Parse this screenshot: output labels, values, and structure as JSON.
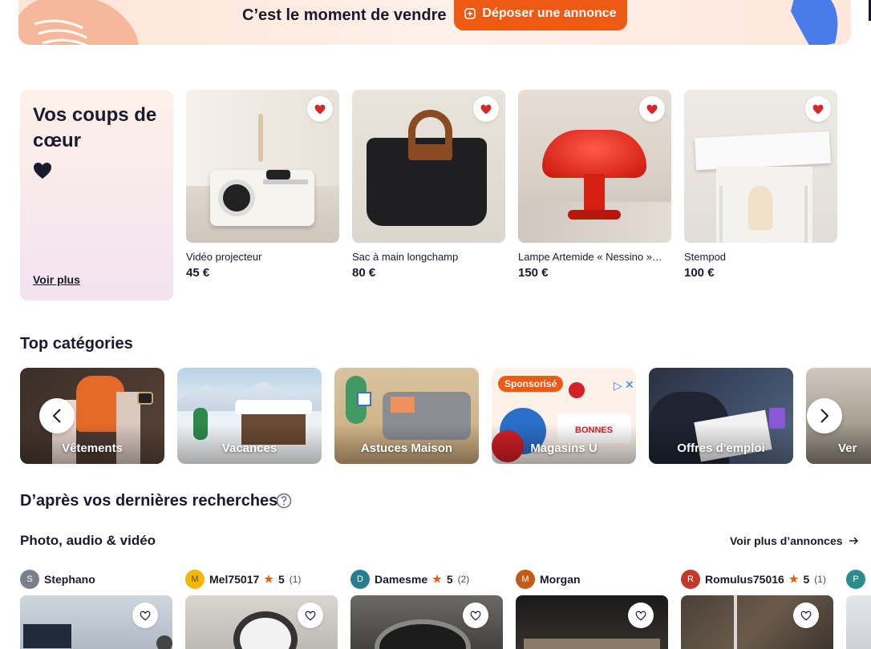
{
  "banner": {
    "text": "C’est le moment de vendre",
    "button_label": "Déposer une annonce"
  },
  "favorites": {
    "title": "Vos coups de cœur",
    "see_more": "Voir plus",
    "products": [
      {
        "title": "Vidéo projecteur",
        "price": "45 €"
      },
      {
        "title": "Sac à main longchamp",
        "price": "80 €"
      },
      {
        "title": "Lampe Artemide « Nessino »…",
        "price": "150 €"
      },
      {
        "title": "Stempod",
        "price": "100 €"
      }
    ]
  },
  "categories": {
    "title": "Top catégories",
    "items": [
      {
        "label": "Vêtements"
      },
      {
        "label": "Vacances"
      },
      {
        "label": "Astuces Maison"
      },
      {
        "label": "Magasins U",
        "badge": "Sponsorisé"
      },
      {
        "label": "Offres d'emploi"
      },
      {
        "label": "Ver"
      }
    ]
  },
  "recent": {
    "title": "D’après vos dernières recherches",
    "subsection_title": "Photo, audio & vidéo",
    "see_more": "Voir plus d’annonces",
    "sellers": [
      {
        "initial": "S",
        "name": "Stephano",
        "rating": "",
        "count": "",
        "color": "#7a7f8c"
      },
      {
        "initial": "M",
        "name": "Mel75017",
        "rating": "5",
        "count": "(1)",
        "color": "#f2b705"
      },
      {
        "initial": "D",
        "name": "Damesme",
        "rating": "5",
        "count": "(2)",
        "color": "#2a7d8c"
      },
      {
        "initial": "M",
        "name": "Morgan",
        "rating": "",
        "count": "",
        "color": "#c15a14"
      },
      {
        "initial": "R",
        "name": "Romulus75016",
        "rating": "5",
        "count": "(1)",
        "color": "#c0392b"
      },
      {
        "initial": "P",
        "name": "",
        "rating": "",
        "count": "",
        "color": "#2a8c8c"
      }
    ]
  },
  "colors": {
    "accent": "#ec5a13",
    "text": "#1a1a2e",
    "heart": "#d62828"
  }
}
